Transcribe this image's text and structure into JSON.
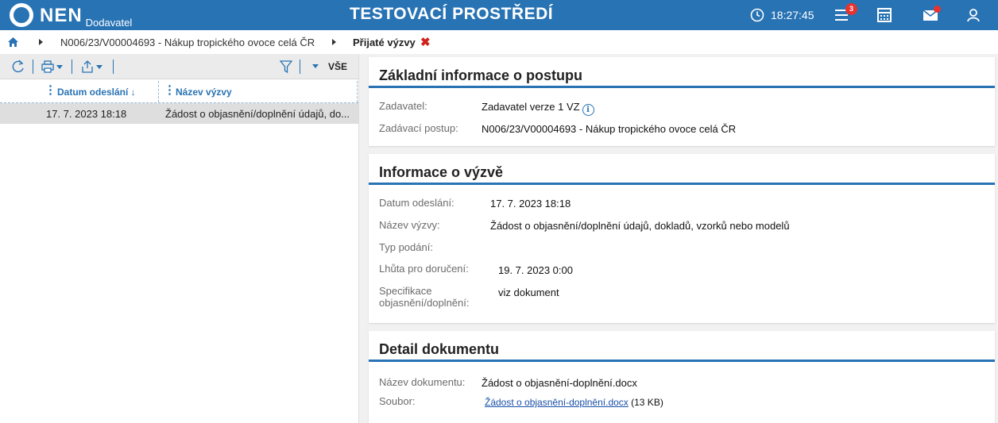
{
  "app": {
    "logo_name": "NEN",
    "logo_sub": "Dodavatel",
    "env_title": "TESTOVACÍ PROSTŘEDÍ",
    "clock": "18:27:45",
    "menu_badge": "3"
  },
  "breadcrumb": {
    "item1": "N006/23/V00004693 - Nákup tropického ovoce celá ČR",
    "item2": "Přijaté výzvy",
    "close_symbol": "✖"
  },
  "left_panel": {
    "filter_label": "VŠE",
    "columns": [
      "Datum odeslání ↓",
      "Název výzvy"
    ],
    "rows": [
      [
        "17. 7. 2023 18:18",
        "Žádost o objasnění/doplnění údajů, do..."
      ]
    ]
  },
  "sections": {
    "basic": {
      "title": "Základní informace o postupu",
      "zadavatel_label": "Zadavatel:",
      "zadavatel_value": "Zadavatel verze 1 VZ",
      "postup_label": "Zadávací postup:",
      "postup_value": "N006/23/V00004693 - Nákup tropického ovoce celá ČR"
    },
    "vyzva": {
      "title": "Informace o výzvě",
      "datum_label": "Datum odeslání:",
      "datum_value": "17. 7. 2023 18:18",
      "nazev_label": "Název výzvy:",
      "nazev_value": "Žádost o objasnění/doplnění údajů, dokladů, vzorků nebo modelů",
      "typ_label": "Typ podání:",
      "typ_value": "",
      "lhuta_label": "Lhůta pro doručení:",
      "lhuta_value": "19. 7. 2023 0:00",
      "spec_label_1": "Specifikace",
      "spec_label_2": "objasnění/doplnění:",
      "spec_value": "viz dokument"
    },
    "detail": {
      "title": "Detail dokumentu",
      "nazev_label": "Název dokumentu:",
      "nazev_value": "Žádost o objasnění-doplnění.docx",
      "soubor_label": "Soubor:",
      "soubor_link": "Žádost o objasnění-doplnění.docx",
      "soubor_size": " (13 KB)"
    }
  },
  "colors": {
    "brand": "#2873b4",
    "alert": "#e8322e"
  }
}
